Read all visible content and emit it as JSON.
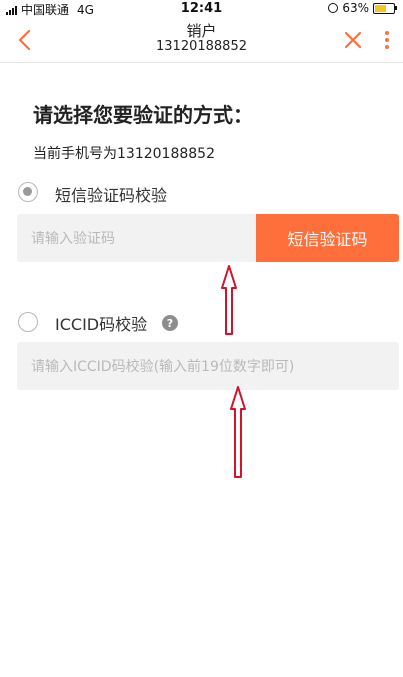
{
  "status_bar": {
    "carrier": "中国联通",
    "network": "4G",
    "time": "12:41",
    "battery": "63%",
    "battery_level": 0.63
  },
  "nav": {
    "title": "销户",
    "subtitle": "13120188852"
  },
  "page": {
    "heading": "请选择您要验证的方式：",
    "phone_line": "当前手机号为13120188852"
  },
  "option_sms": {
    "label": "短信验证码校验",
    "selected": true,
    "input_placeholder": "请输入验证码",
    "button_label": "短信验证码"
  },
  "option_iccid": {
    "label": "ICCID码校验",
    "selected": false,
    "help_icon": "?",
    "input_placeholder": "请输入ICCID码校验(输入前19位数字即可)"
  },
  "colors": {
    "accent": "#ff6f3c",
    "annotation_arrow": "#d0142c"
  }
}
